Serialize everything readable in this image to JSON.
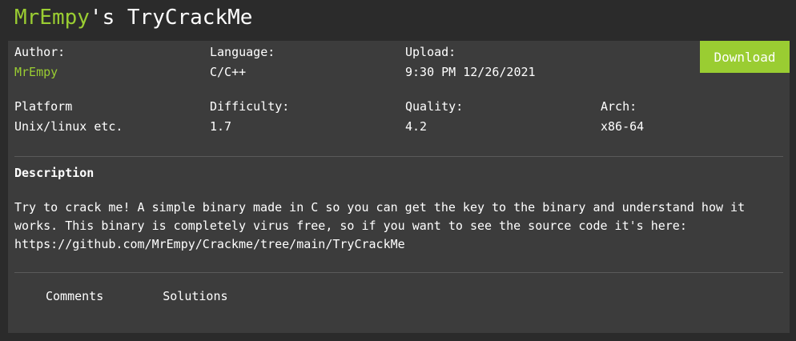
{
  "header": {
    "author_name": "MrEmpy",
    "title_suffix": "'s TryCrackMe"
  },
  "info": {
    "author": {
      "label": "Author:",
      "value": "MrEmpy"
    },
    "language": {
      "label": "Language:",
      "value": "C/C++"
    },
    "upload": {
      "label": "Upload:",
      "value": "9:30 PM 12/26/2021"
    },
    "platform": {
      "label": "Platform",
      "value": "Unix/linux etc."
    },
    "difficulty": {
      "label": "Difficulty:",
      "value": "1.7"
    },
    "quality": {
      "label": "Quality:",
      "value": "4.2"
    },
    "arch": {
      "label": "Arch:",
      "value": "x86-64"
    }
  },
  "download_label": "Download",
  "description": {
    "heading": "Description",
    "text": "Try to crack me! A simple binary made in C so you can get the key to the binary and understand how it works. This binary is completely virus free, so if you want to see the source code it's here: https://github.com/MrEmpy/Crackme/tree/main/TryCrackMe"
  },
  "tabs": [
    {
      "label": "Comments"
    },
    {
      "label": "Solutions"
    }
  ],
  "colors": {
    "accent": "#9acd32",
    "background": "#2b2b2b",
    "panel": "#3c3c3c",
    "text": "#ffffff"
  }
}
